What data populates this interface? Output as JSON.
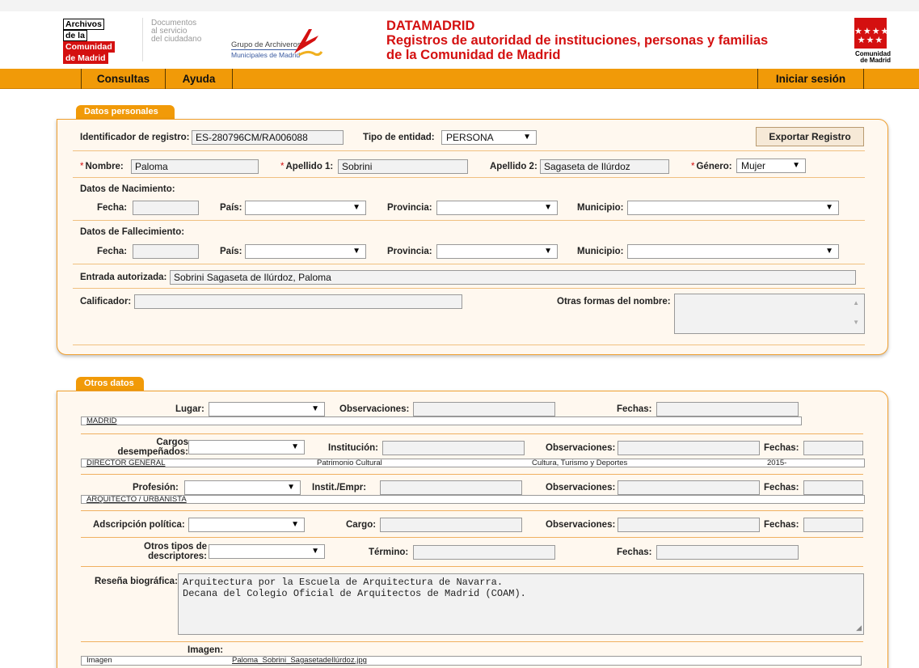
{
  "header": {
    "logo_lines": [
      "Archivos",
      "de la",
      "Comunidad",
      "de Madrid"
    ],
    "documentos": "Documentos\nal servicio\ndel ciudadano",
    "grupo_title": "Grupo de Archiveros",
    "grupo_sub": "Municipales de Madrid",
    "title_line1": "DATAMADRID",
    "title_line2": "Registros de autoridad de instituciones, personas y familias",
    "title_line3": "de la Comunidad de Madrid",
    "cm_stars": "★★★★\n★★★",
    "cm_text_1": "Comunidad",
    "cm_text_2": "de Madrid"
  },
  "nav": {
    "consultas": "Consultas",
    "ayuda": "Ayuda",
    "login": "Iniciar sesión"
  },
  "personal": {
    "tab": "Datos personales",
    "id_label": "Identificador de registro:",
    "id_value": "ES-280796CM/RA006088",
    "tipo_label": "Tipo de entidad:",
    "tipo_value": "PERSONA",
    "export_button": "Exportar Registro",
    "nombre_label": "Nombre:",
    "nombre_value": "Paloma",
    "apellido1_label": "Apellido 1:",
    "apellido1_value": "Sobrini",
    "apellido2_label": "Apellido 2:",
    "apellido2_value": "Sagaseta de Ilúrdoz",
    "genero_label": "Género:",
    "genero_value": "Mujer",
    "nacimiento_title": "Datos de Nacimiento:",
    "fallecimiento_title": "Datos de Fallecimiento:",
    "fecha_label": "Fecha:",
    "pais_label": "País:",
    "provincia_label": "Provincia:",
    "municipio_label": "Municipio:",
    "entrada_label": "Entrada autorizada:",
    "entrada_value": "Sobrini Sagaseta de Ilúrdoz, Paloma",
    "calificador_label": "Calificador:",
    "otras_formas_label": "Otras formas del nombre:"
  },
  "otros": {
    "tab": "Otros datos",
    "lugar_label": "Lugar:",
    "observaciones_label": "Observaciones:",
    "fechas_label": "Fechas:",
    "lugar_result": "MADRID",
    "cargos_label_1": "Cargos",
    "cargos_label_2": "desempeñados:",
    "institucion_label": "Institución:",
    "cargo_result": "DIRECTOR GENERAL",
    "cargo_institucion": "Patrimonio Cultural",
    "cargo_observaciones": "Cultura, Turismo y Deportes",
    "cargo_fechas": "2015-",
    "profesion_label": "Profesión:",
    "instit_label": "Instit./Empr:",
    "profesion_result": "ARQUITECTO / URBANISTA",
    "adscripcion_label": "Adscripción política:",
    "cargo_label": "Cargo:",
    "otros_tipos_1": "Otros tipos de",
    "otros_tipos_2": "descriptores:",
    "termino_label": "Término:",
    "resena_label": "Reseña biográfica:",
    "resena_line1": "Arquitectura por la Escuela de Arquitectura de Navarra.",
    "resena_line2": "Decana del Colegio Oficial de Arquitectos de Madrid (COAM).",
    "imagen_label": "Imagen:",
    "imagen_col": "Imagen",
    "imagen_file": "Paloma_Sobrini_SagasetadeIlúrdoz.jpg"
  },
  "colors": {
    "accent": "#f19a08",
    "brand_red": "#d41010",
    "panel_bg": "#fff8ef"
  },
  "icons": [
    "dropdown-arrow-icon",
    "scroll-up-icon",
    "scroll-down-icon",
    "resize-handle-icon"
  ]
}
